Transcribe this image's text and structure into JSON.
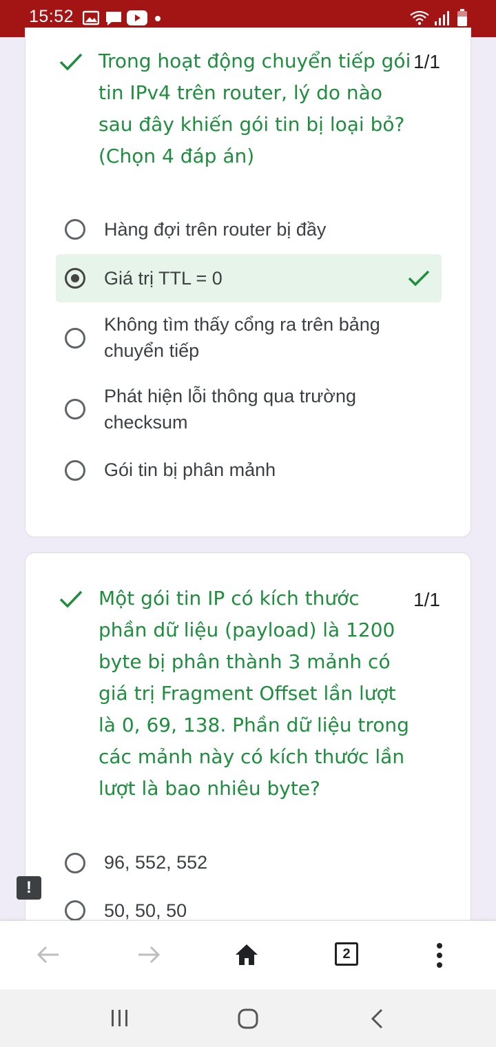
{
  "status_bar": {
    "time": "15:52",
    "icons": [
      "image-icon",
      "chat-icon",
      "youtube-icon",
      "dot-icon",
      "wifi-icon",
      "signal-icon",
      "battery-icon"
    ]
  },
  "question1": {
    "text_lines": [
      "Trong hoạt động chuyển tiếp gói",
      "tin IPv4 trên router, lý do nào",
      "sau đây khiến gói tin bị loại bỏ?",
      "(Chọn 4 đáp án)"
    ],
    "score": "1/1",
    "options": [
      {
        "lines": [
          "Hàng đợi trên router bị đầy"
        ],
        "selected": false,
        "correct": false
      },
      {
        "lines": [
          "Giá trị TTL = 0"
        ],
        "selected": true,
        "correct": true
      },
      {
        "lines": [
          "Không tìm thấy cổng ra trên bảng",
          "chuyển tiếp"
        ],
        "selected": false,
        "correct": false
      },
      {
        "lines": [
          "Phát hiện lỗi thông qua trường",
          "checksum"
        ],
        "selected": false,
        "correct": false
      },
      {
        "lines": [
          "Gói tin bị phân mảnh"
        ],
        "selected": false,
        "correct": false
      }
    ]
  },
  "question2": {
    "text_lines": [
      "Một gói tin IP có kích thước",
      "phần dữ liệu (payload) là 1200",
      "byte bị phân thành 3 mảnh có",
      "giá trị Fragment Offset lần lượt",
      "là 0, 69, 138. Phần dữ liệu trong",
      "các mảnh này có kích thước lần",
      "lượt là bao nhiêu byte?"
    ],
    "score": "1/1",
    "options": [
      {
        "lines": [
          "96, 552, 552"
        ],
        "selected": false
      },
      {
        "lines": [
          "50, 50, 50"
        ],
        "selected": false
      }
    ]
  },
  "feedback_badge": "!",
  "browser_bar": {
    "tab_count": "2",
    "icons": [
      "back-arrow-icon",
      "forward-arrow-icon",
      "home-icon",
      "tab-switcher-icon",
      "more-vert-icon"
    ]
  },
  "nav_bar": {
    "icons": [
      "recent-apps-icon",
      "home-nav-icon",
      "back-nav-icon"
    ]
  },
  "colors": {
    "status_bar": "#a31515",
    "correct_green": "#1e8e3e",
    "correct_bg": "#e6f4ea",
    "page_bg": "#efebf7"
  }
}
